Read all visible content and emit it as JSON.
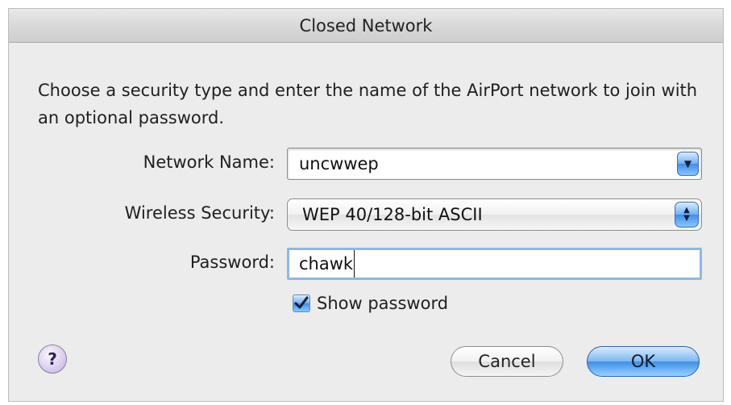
{
  "window": {
    "title": "Closed Network"
  },
  "instructions": "Choose a security type and enter the name of the AirPort network to join with an optional password.",
  "network_name": {
    "label": "Network Name:",
    "value": "uncwwep",
    "arrow_icon": "chevron-down-icon"
  },
  "wireless_security": {
    "label": "Wireless Security:",
    "value": "WEP 40/128-bit ASCII",
    "arrow_icon": "up-down-arrows-icon"
  },
  "password": {
    "label": "Password:",
    "value": "chawk"
  },
  "show_password": {
    "label": "Show password",
    "checked": true
  },
  "buttons": {
    "help": "?",
    "cancel": "Cancel",
    "ok": "OK"
  },
  "colors": {
    "accent_blue": "#3e8ee6",
    "focus_ring": "#8fb6e6",
    "window_bg": "#ececec"
  }
}
